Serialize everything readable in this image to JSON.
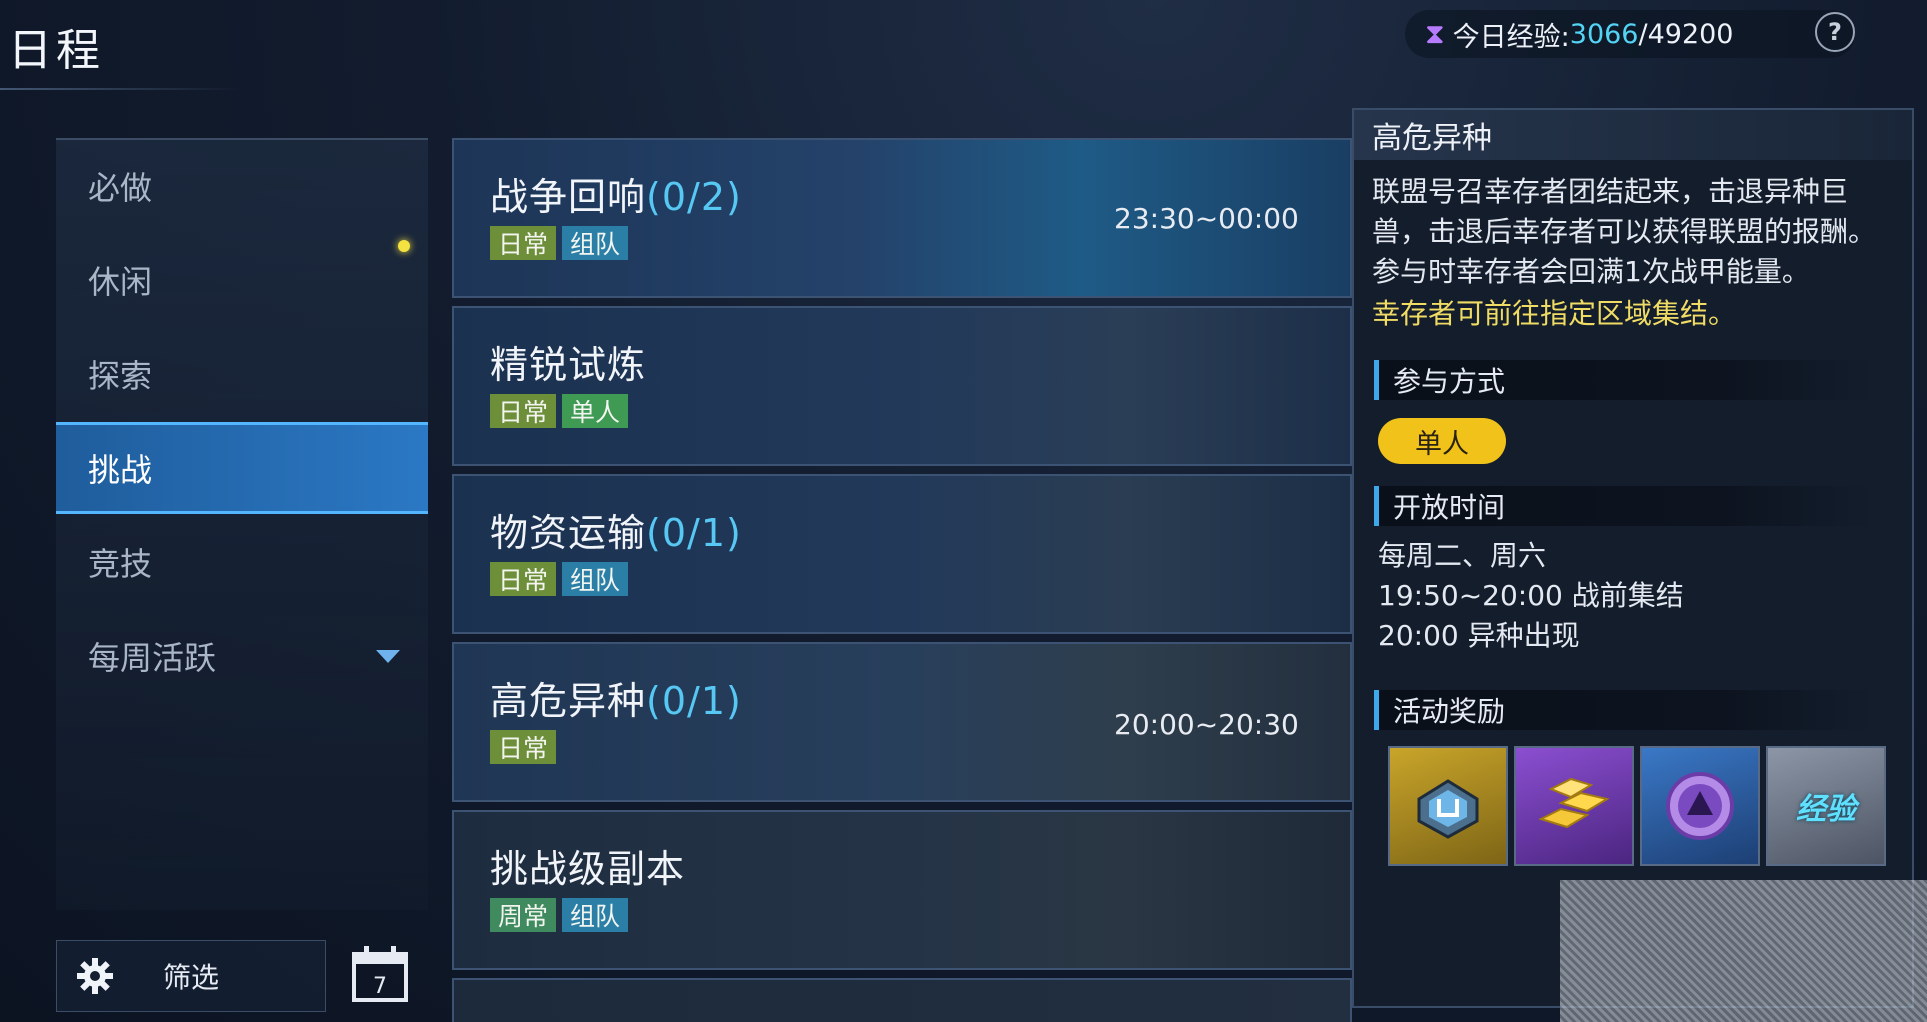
{
  "header": {
    "title": "日程",
    "exp_label": "今日经验:",
    "exp_current": "3066",
    "exp_max": "/49200",
    "help": "?"
  },
  "sidebar": {
    "items": [
      {
        "label": "必做",
        "active": false
      },
      {
        "label": "休闲",
        "active": false,
        "dot": true
      },
      {
        "label": "探索",
        "active": false
      },
      {
        "label": "挑战",
        "active": true
      },
      {
        "label": "竞技",
        "active": false
      },
      {
        "label": "每周活跃",
        "active": false,
        "expandable": true
      }
    ],
    "filter_label": "筛选",
    "calendar_day": "7"
  },
  "activities": [
    {
      "name": "战争回响",
      "progress": "(0/2)",
      "tags": [
        "日常",
        "组队"
      ],
      "time": "23:30~00:00"
    },
    {
      "name": "精锐试炼",
      "progress": "",
      "tags": [
        "日常",
        "单人"
      ],
      "time": ""
    },
    {
      "name": "物资运输",
      "progress": "(0/1)",
      "tags": [
        "日常",
        "组队"
      ],
      "time": ""
    },
    {
      "name": "高危异种",
      "progress": "(0/1)",
      "tags": [
        "日常"
      ],
      "time": "20:00~20:30"
    },
    {
      "name": "挑战级副本",
      "progress": "",
      "tags": [
        "周常",
        "组队"
      ],
      "time": ""
    }
  ],
  "detail": {
    "title": "高危异种",
    "description": "联盟号召幸存者团结起来，击退异种巨兽，击退后幸存者可以获得联盟的报酬。参与时幸存者会回满1次战甲能量。",
    "note": "幸存者可前往指定区域集结。",
    "participation_heading": "参与方式",
    "participation_mode": "单人",
    "open_time_heading": "开放时间",
    "open_time_lines": [
      "每周二、周六",
      "19:50~20:00 战前集结",
      "20:00 异种出现"
    ],
    "rewards_heading": "活动奖励",
    "rewards": [
      {
        "icon": "armor-chip-icon",
        "rarity": "gold"
      },
      {
        "icon": "gold-bars-icon",
        "rarity": "purple"
      },
      {
        "icon": "purple-coin-icon",
        "rarity": "blue"
      },
      {
        "icon": "exp-icon",
        "label": "经验",
        "rarity": "gray"
      }
    ]
  },
  "colors": {
    "accent_blue": "#2b78c4",
    "progress_cyan": "#56c8f3",
    "note_yellow": "#f0dc64",
    "pill_yellow": "#f1c21a"
  }
}
